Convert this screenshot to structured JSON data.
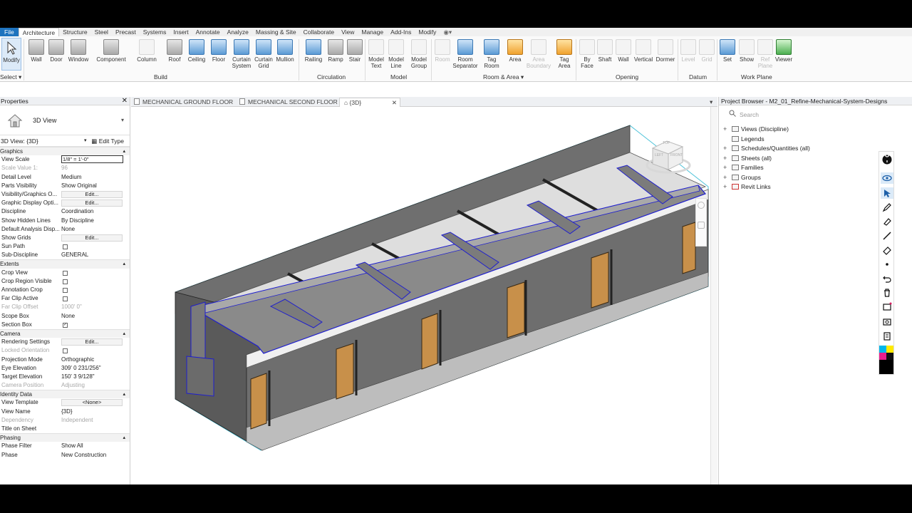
{
  "menu": {
    "tabs": [
      "File",
      "Architecture",
      "Structure",
      "Steel",
      "Precast",
      "Systems",
      "Insert",
      "Annotate",
      "Analyze",
      "Massing & Site",
      "Collaborate",
      "View",
      "Manage",
      "Add-Ins",
      "Modify"
    ],
    "active": "Architecture"
  },
  "ribbon": {
    "buttons": [
      "Modify",
      "Wall",
      "Door",
      "Window",
      "Component",
      "Column",
      "Roof",
      "Ceiling",
      "Floor",
      "Curtain\nSystem",
      "Curtain\nGrid",
      "Mullion",
      "Railing",
      "Ramp",
      "Stair",
      "Model\nText",
      "Model\nLine",
      "Model\nGroup",
      "Room",
      "Room\nSeparator",
      "Tag\nRoom",
      "Area",
      "Area\nBoundary",
      "Tag\nArea",
      "By\nFace",
      "Shaft",
      "Wall",
      "Vertical",
      "Dormer",
      "Level",
      "Grid",
      "Set",
      "Show",
      "Ref\nPlane",
      "Viewer"
    ],
    "panels": [
      "Select",
      "Build",
      "Circulation",
      "Model",
      "Room & Area",
      "Opening",
      "Datum",
      "Work Plane"
    ]
  },
  "properties": {
    "title": "Properties",
    "type_name": "3D View",
    "instance": "3D View: {3D}",
    "edit_type": "Edit Type",
    "rows": [
      {
        "k": "Graphics",
        "section": true
      },
      {
        "k": "View Scale",
        "v": "1/8\" = 1'-0\"",
        "kind": "input"
      },
      {
        "k": "Scale Value    1:",
        "v": "96",
        "dis": true
      },
      {
        "k": "Detail Level",
        "v": "Medium"
      },
      {
        "k": "Parts Visibility",
        "v": "Show Original"
      },
      {
        "k": "Visibility/Graphics O...",
        "v": "Edit...",
        "kind": "btn"
      },
      {
        "k": "Graphic Display Opti...",
        "v": "Edit...",
        "kind": "btn"
      },
      {
        "k": "Discipline",
        "v": "Coordination"
      },
      {
        "k": "Show Hidden Lines",
        "v": "By Discipline"
      },
      {
        "k": "Default Analysis Disp...",
        "v": "None"
      },
      {
        "k": "Show Grids",
        "v": "Edit...",
        "kind": "btn"
      },
      {
        "k": "Sun Path",
        "v": "",
        "kind": "cb"
      },
      {
        "k": "Sub-Discipline",
        "v": "GENERAL"
      },
      {
        "k": "Extents",
        "section": true
      },
      {
        "k": "Crop View",
        "v": "",
        "kind": "cb"
      },
      {
        "k": "Crop Region Visible",
        "v": "",
        "kind": "cb"
      },
      {
        "k": "Annotation Crop",
        "v": "",
        "kind": "cb"
      },
      {
        "k": "Far Clip Active",
        "v": "",
        "kind": "cb"
      },
      {
        "k": "Far Clip Offset",
        "v": "1000'  0\"",
        "dis": true
      },
      {
        "k": "Scope Box",
        "v": "None"
      },
      {
        "k": "Section Box",
        "v": "✓",
        "kind": "cb"
      },
      {
        "k": "Camera",
        "section": true
      },
      {
        "k": "Rendering Settings",
        "v": "Edit...",
        "kind": "btn"
      },
      {
        "k": "Locked Orientation",
        "v": "",
        "kind": "cb",
        "dis": true
      },
      {
        "k": "Projection Mode",
        "v": "Orthographic"
      },
      {
        "k": "Eye Elevation",
        "v": "309'  0 231/256\""
      },
      {
        "k": "Target Elevation",
        "v": "150'  3 9/128\""
      },
      {
        "k": "Camera Position",
        "v": "Adjusting",
        "dis": true
      },
      {
        "k": "Identity Data",
        "section": true
      },
      {
        "k": "View Template",
        "v": "<None>",
        "kind": "btn"
      },
      {
        "k": "View Name",
        "v": "{3D}"
      },
      {
        "k": "Dependency",
        "v": "Independent",
        "dis": true
      },
      {
        "k": "Title on Sheet",
        "v": ""
      },
      {
        "k": "Phasing",
        "section": true
      },
      {
        "k": "Phase Filter",
        "v": "Show All"
      },
      {
        "k": "Phase",
        "v": "New Construction"
      }
    ]
  },
  "view_tabs": {
    "tab1": "MECHANICAL GROUND FLOOR",
    "tab2": "MECHANICAL SECOND FLOOR",
    "tab3": "{3D}"
  },
  "viewcube": {
    "top": "TOP",
    "left": "LEFT",
    "front": "FRONT"
  },
  "browser": {
    "title": "Project Browser - M2_01_Refine-Mechanical-System-Designs",
    "search_placeholder": "Search",
    "items": [
      "Views (Discipline)",
      "Legends",
      "Schedules/Quantities (all)",
      "Sheets (all)",
      "Families",
      "Groups",
      "Revit Links"
    ]
  },
  "colors": {
    "accent": "#1e73be",
    "duct_outline": "#1e1ecf",
    "door": "#c8904a",
    "wall": "#6e6e6e"
  }
}
